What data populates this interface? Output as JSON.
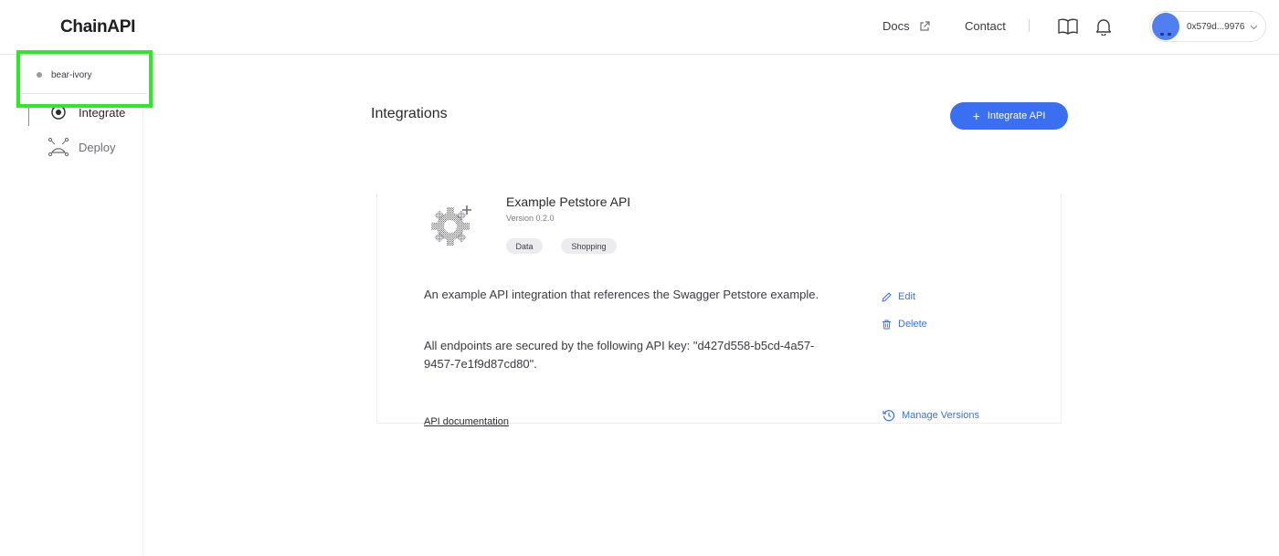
{
  "header": {
    "logo": "ChainAPI",
    "nav_docs": "Docs",
    "nav_contact": "Contact",
    "account_address": "0x579d...9976"
  },
  "sidebar": {
    "project_name": "bear-ivory",
    "items": [
      {
        "label": "Integrate"
      },
      {
        "label": "Deploy"
      }
    ]
  },
  "main": {
    "title": "Integrations",
    "integrate_button": "Integrate API",
    "card": {
      "name": "Example Petstore API",
      "version": "Version 0.2.0",
      "tags": [
        "Data",
        "Shopping"
      ],
      "description": "An example API integration that references the Swagger Petstore example.",
      "key_note": "All endpoints are secured by the following API key: \"d427d558-b5cd-4a57-9457-7e1f9d87cd80\".",
      "edit_label": "Edit",
      "delete_label": "Delete",
      "manage_versions_label": "Manage Versions",
      "doc_link": "API documentation"
    }
  },
  "colors": {
    "accent": "#3a6ff2",
    "highlight": "#2ee82a"
  }
}
